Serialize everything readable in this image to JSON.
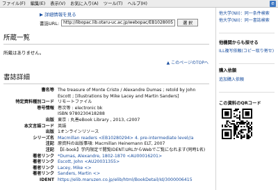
{
  "menubar": {
    "items": [
      {
        "id": "file",
        "label": "ファイル(F)"
      },
      {
        "id": "edit",
        "label": "編集(E)"
      },
      {
        "id": "view",
        "label": "表示(V)"
      },
      {
        "id": "favorites",
        "label": "お気に入り(A)"
      },
      {
        "id": "tools",
        "label": "ツール(T)"
      },
      {
        "id": "help",
        "label": "ヘルプ(H)"
      }
    ],
    "icon": "browser-app-icon"
  },
  "detail": {
    "link_label": "▶ 詳細情報を見る"
  },
  "url_row": {
    "label": "書誌URL:",
    "value": "http://libopac.lib.otaru-uc.ac.jp/webopac/EB10280051",
    "button_label": "選 択"
  },
  "holdings": {
    "heading": "所蔵一覧",
    "empty_text": "所蔵はありません。",
    "top_link": "▲ このページのTOPへ"
  },
  "biblio": {
    "heading": "書誌詳細",
    "rows": [
      {
        "label": "書名等",
        "value": "The treasure of Monte Cristo / Alexandre Dumas ; retold by John Escott ; [illustrations by Mike Lacey and Martin Sanders]",
        "link": false
      },
      {
        "label": "特定資料種別コード",
        "value": "リモートファイル",
        "link": false
      },
      {
        "label": "巻号情報",
        "value": "巻次等 : electronic bk",
        "link": false
      },
      {
        "label": "",
        "value": "ISBN  9780230418288",
        "link": false
      },
      {
        "label": "出版",
        "value": "東京 : 丸善eBook Library , 2013, c2007",
        "link": false
      },
      {
        "label": "本文言語コード",
        "value": "英語",
        "link": false
      },
      {
        "label": "出版",
        "value": "1オンラインリソース",
        "link": false
      },
      {
        "label": "シリーズ名",
        "value": "Macmillan readers <EB10280294> 4. pre-intermediate level//a",
        "link": true
      },
      {
        "label": "注記",
        "value": "原資料の出版事項: Macmillan Heinemann ELT, 2007",
        "link": false
      },
      {
        "label": "注記",
        "value": "【E-book】学内限定で閲覧IDENT:URLからWebでご覧になれます(同時1名)",
        "link": false
      },
      {
        "label": "著者リンク",
        "value": "*Dumas, Alexandre, 1802-1870 <AU00016201>",
        "link": true
      },
      {
        "label": "著者リンク",
        "value": "Escott, John <AU20031355>",
        "link": true
      },
      {
        "label": "著者リンク",
        "value": "Lacey, Mike <>",
        "link": true
      },
      {
        "label": "著者リンク",
        "value": "Sanders, Martin <>",
        "link": true
      },
      {
        "label": "IDENT",
        "value": "https://elib.maruzen.co.jp/elib/html/BookDetail/Id/3000006415",
        "link": true
      }
    ]
  },
  "sidebar": {
    "links": [
      "他大学(NII)：同一条件検索",
      "他大学(NII)：同一書誌検索"
    ],
    "other_heading": "他機関からも探せる",
    "ill_link": "ILL複写依頼(コピー取り寄せ)",
    "purchase_heading": "購入依頼",
    "purchase_link": "追加購入依頼",
    "qr_heading": "この資料のQRコード"
  }
}
